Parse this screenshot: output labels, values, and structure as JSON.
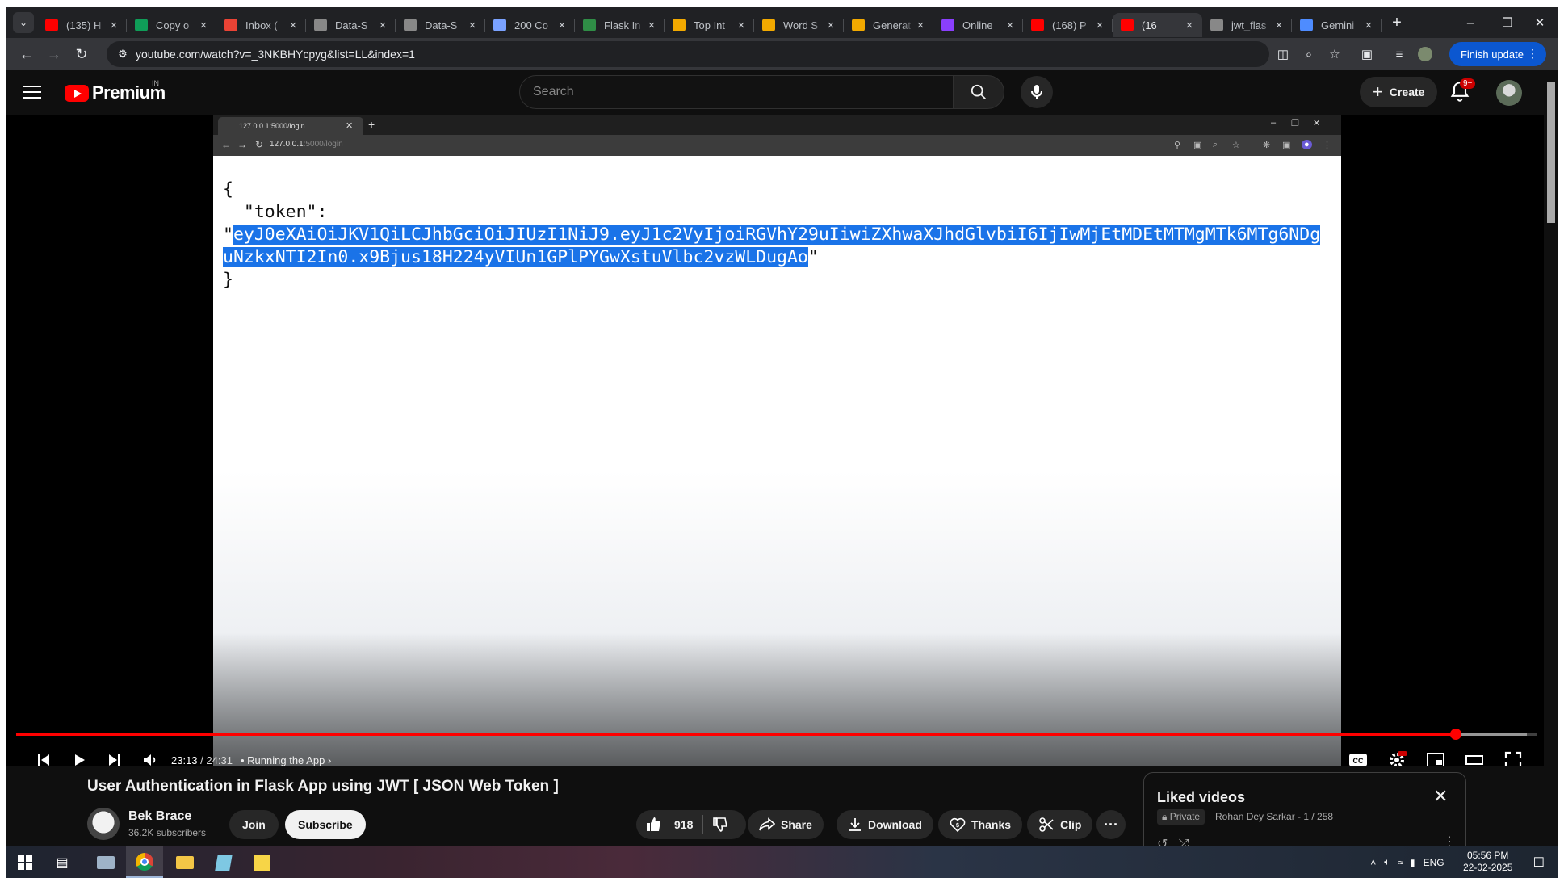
{
  "browser": {
    "tabs": [
      {
        "title": "(135) H",
        "icon": "youtube-icon",
        "color": "#ff0000"
      },
      {
        "title": "Copy o",
        "icon": "sheets-icon",
        "color": "#0f9d58"
      },
      {
        "title": "Inbox (",
        "icon": "gmail-icon",
        "color": "#ea4335"
      },
      {
        "title": "Data-S",
        "icon": "github-icon",
        "color": "#888888"
      },
      {
        "title": "Data-S",
        "icon": "github-icon",
        "color": "#888888"
      },
      {
        "title": "200 Co",
        "icon": "site-icon",
        "color": "#7aa2ff"
      },
      {
        "title": "Flask In",
        "icon": "gfg-icon",
        "color": "#2f8d46"
      },
      {
        "title": "Top Int",
        "icon": "site-icon",
        "color": "#f2a900"
      },
      {
        "title": "Word S",
        "icon": "site-icon",
        "color": "#f2a900"
      },
      {
        "title": "Generat",
        "icon": "site-icon",
        "color": "#f2a900"
      },
      {
        "title": "Online",
        "icon": "site-icon",
        "color": "#8a3ffc"
      },
      {
        "title": "(168) P",
        "icon": "youtube-icon",
        "color": "#ff0000"
      },
      {
        "title": "(16",
        "icon": "youtube-icon",
        "color": "#ff0000"
      },
      {
        "title": "jwt_flas",
        "icon": "github-icon",
        "color": "#888888"
      },
      {
        "title": "Gemini",
        "icon": "gemini-icon",
        "color": "#4e8cff"
      }
    ],
    "new_tab": "+",
    "url": "youtube.com/watch?v=_3NKBHYcpyg&list=LL&index=1",
    "finish_update": "Finish update"
  },
  "youtube": {
    "logo_text": "Premium",
    "country": "IN",
    "search_placeholder": "Search",
    "create_label": "Create",
    "notif_badge": "9+"
  },
  "video_frame": {
    "tab_title": "127.0.0.1:5000/login",
    "url_host": "127.0.0.1",
    "url_path": ":5000/login",
    "json_open": "{",
    "json_key": "  \"token\":",
    "quote_open": "\"",
    "token_line1": "eyJ0eXAiOiJKV1QiLCJhbGciOiJIUzI1NiJ9.eyJ1c2VyIjoiRGVhY29uIiwiZXhwaXJhdGlvbiI6IjIwMjEtMDEtMTMgMTk6MTg6NDg",
    "token_line2": "uNzkxNTI2In0.x9Bjus18H224yVIUn1GPlPYGwXstuVlbc2vzWLDugAo",
    "quote_close": "\"",
    "json_close": "}"
  },
  "player": {
    "current_time": "23:13",
    "duration": "/ 24:31",
    "chapter": "• Running the App",
    "progress_played_fraction": 0.9465,
    "buffered_fraction": 0.993
  },
  "video": {
    "title": "User Authentication in Flask App using JWT [ JSON Web Token ]",
    "channel": "Bek Brace",
    "subscribers": "36.2K subscribers",
    "join": "Join",
    "subscribe": "Subscribe",
    "likes": "918",
    "share": "Share",
    "download": "Download",
    "thanks": "Thanks",
    "clip": "Clip",
    "more": "···"
  },
  "playlist": {
    "title": "Liked videos",
    "privacy": "Private",
    "meta": "Rohan Dey Sarkar - 1 / 258"
  },
  "taskbar": {
    "lang": "ENG",
    "time": "05:56 PM",
    "date": "22-02-2025"
  }
}
